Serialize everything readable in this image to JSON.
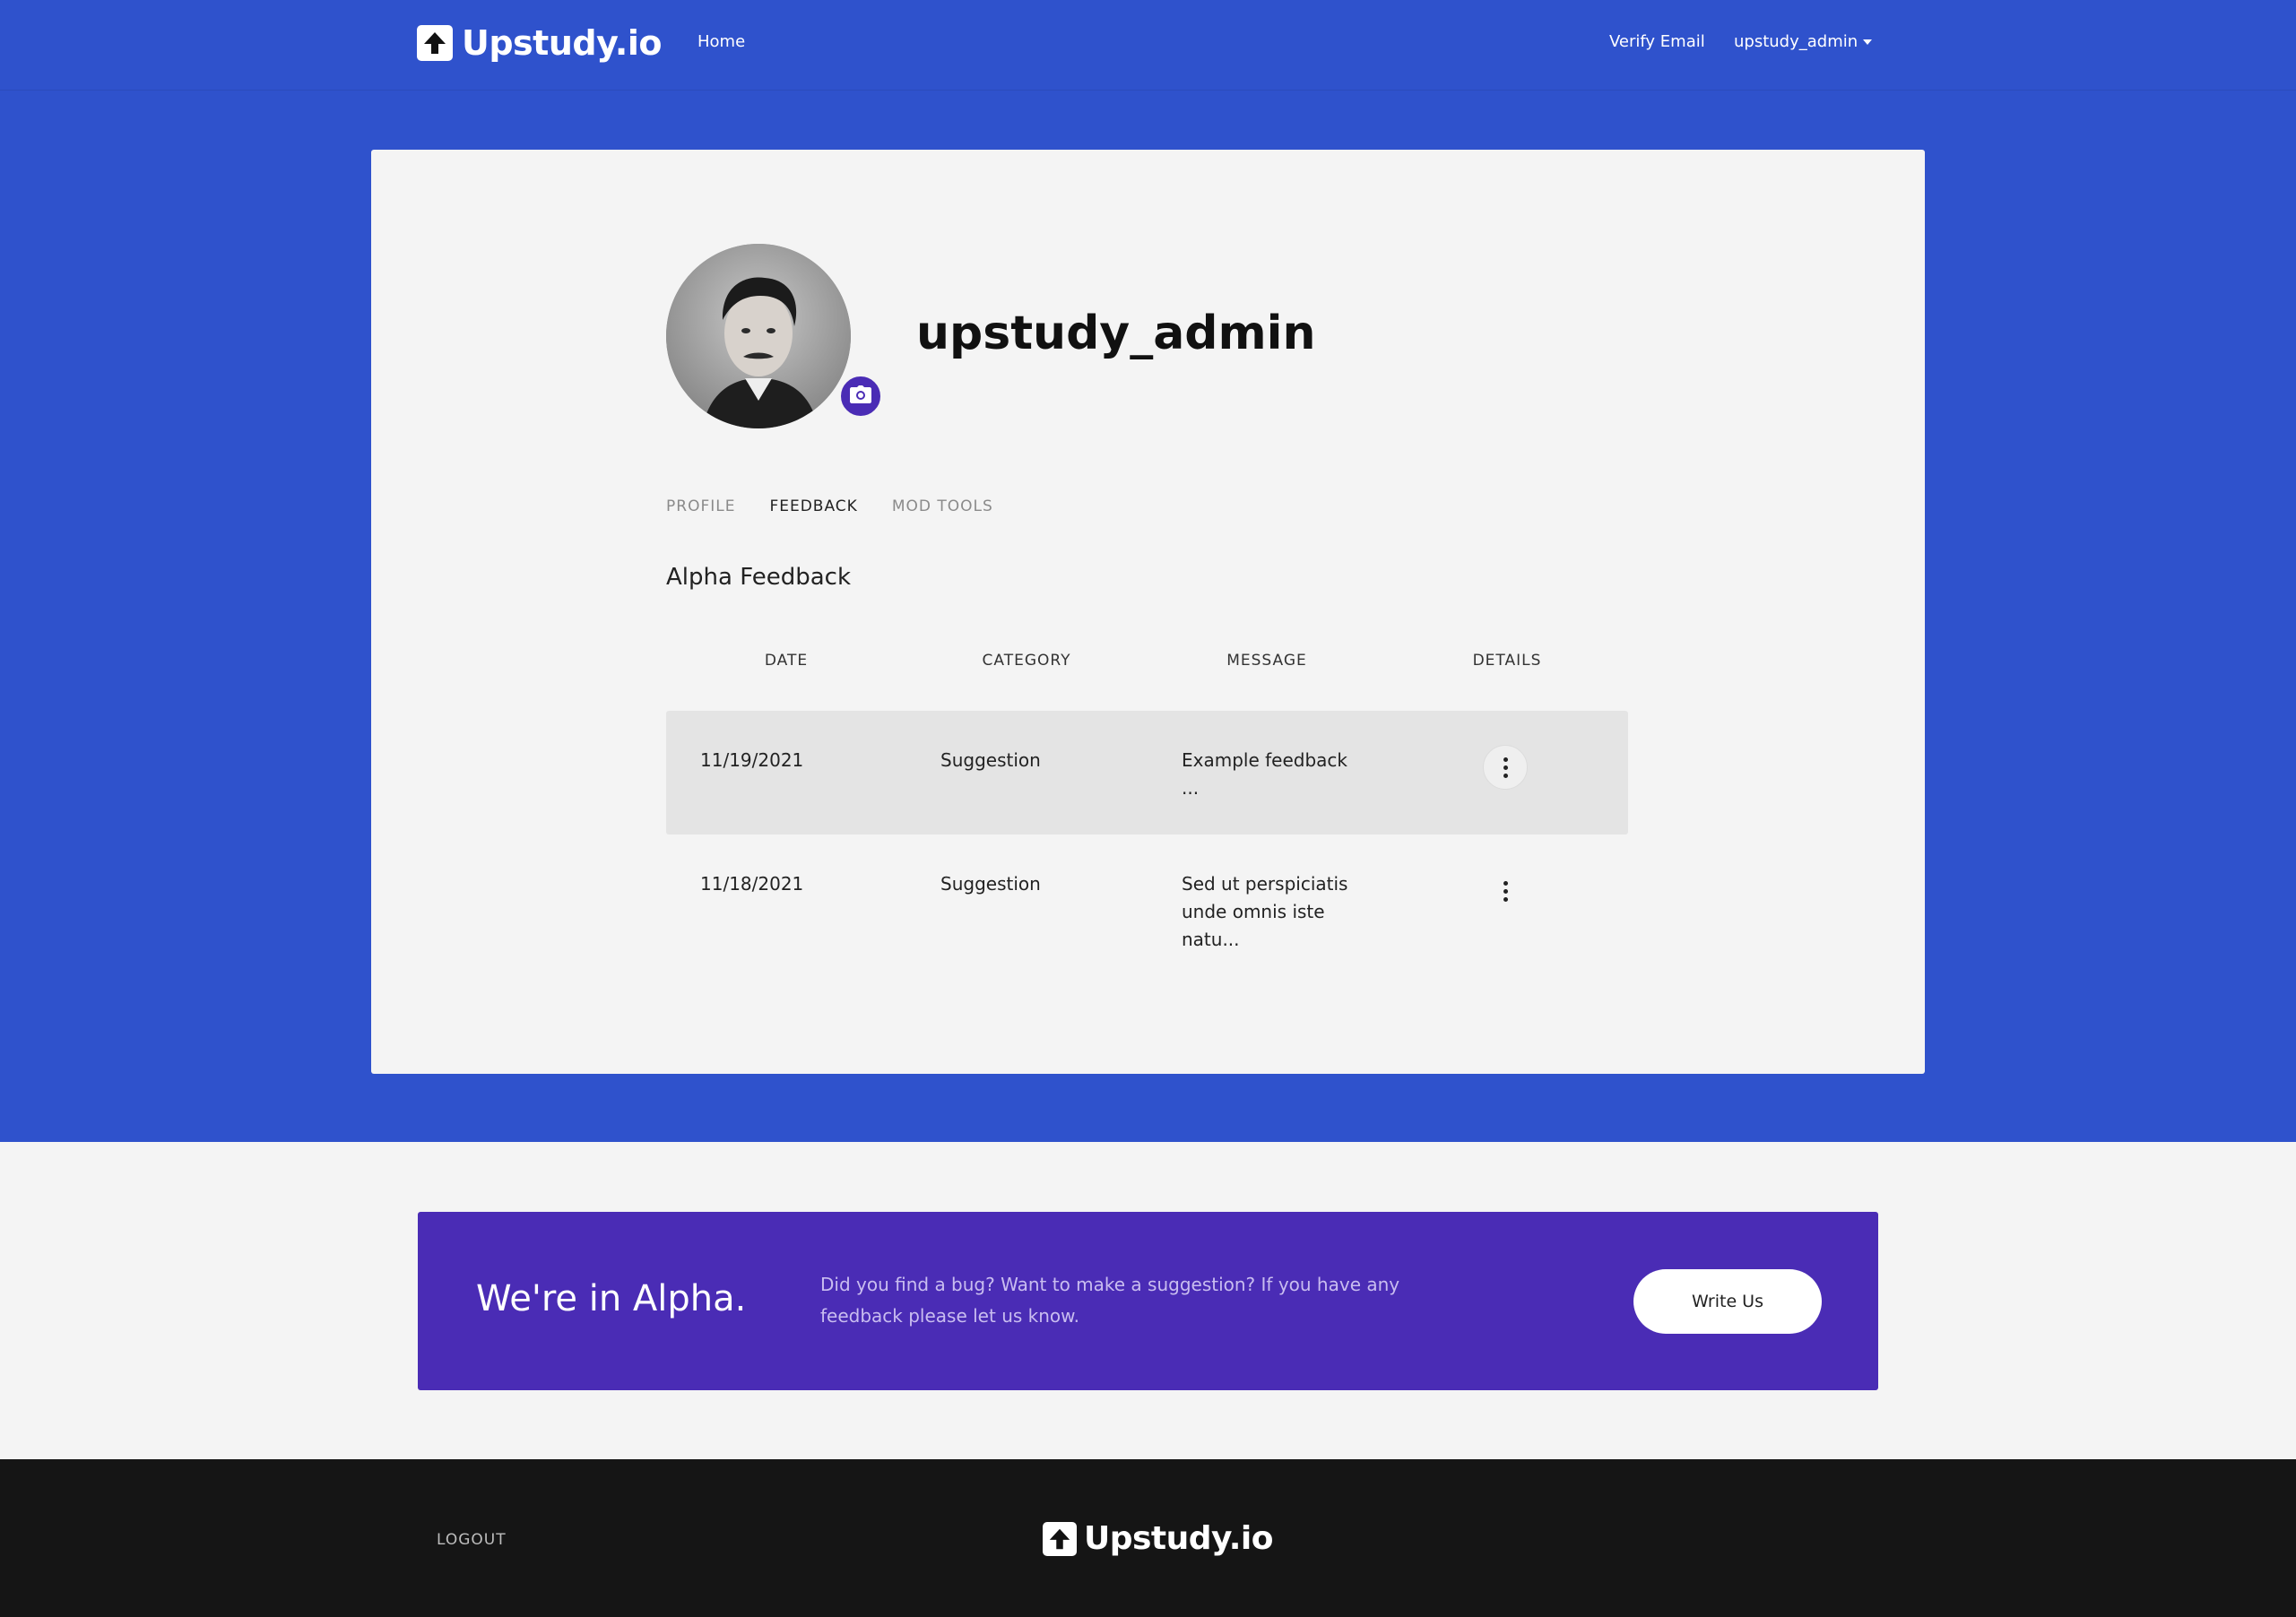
{
  "nav": {
    "brand": "Upstudy.io",
    "home": "Home",
    "verify_email": "Verify Email",
    "user": "upstudy_admin"
  },
  "profile": {
    "username": "upstudy_admin",
    "tabs": [
      {
        "label": "PROFILE",
        "active": false
      },
      {
        "label": "FEEDBACK",
        "active": true
      },
      {
        "label": "MOD TOOLS",
        "active": false
      }
    ],
    "section_title": "Alpha Feedback",
    "table": {
      "headers": [
        "DATE",
        "CATEGORY",
        "MESSAGE",
        "DETAILS"
      ],
      "rows": [
        {
          "date": "11/19/2021",
          "category": "Suggestion",
          "message": "Example feedback ..."
        },
        {
          "date": "11/18/2021",
          "category": "Suggestion",
          "message": "Sed ut perspiciatis unde omnis iste natu..."
        }
      ]
    }
  },
  "banner": {
    "title": "We're in Alpha.",
    "text": "Did you find a bug? Want to make a suggestion? If you have any feedback please let us know.",
    "button": "Write Us"
  },
  "footer": {
    "logout": "LOGOUT",
    "brand": "Upstudy.io"
  },
  "colors": {
    "hero_blue": "#2f52cc",
    "banner_purple": "#4a2cb5",
    "footer_black": "#151515"
  },
  "icons": [
    "arrow-up-logo-icon",
    "caret-down-icon",
    "camera-icon",
    "kebab-menu-icon"
  ]
}
